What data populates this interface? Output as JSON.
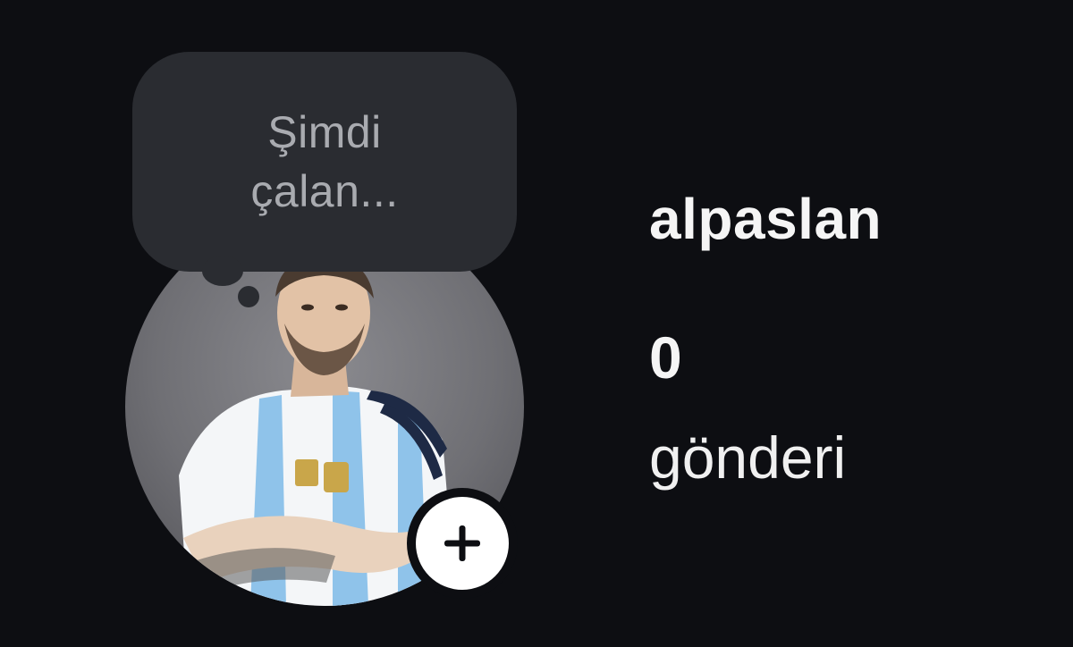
{
  "profile": {
    "note": "Şimdi çalan...",
    "username": "alpaslan",
    "stats": {
      "posts_count": "0",
      "posts_label": "gönderi"
    },
    "avatar_icon": "profile-photo",
    "add_icon": "plus-icon"
  },
  "colors": {
    "background": "#0d0e12",
    "bubble": "#2a2c31",
    "note_text": "#a9abb0",
    "text": "#f5f5f5",
    "add_button": "#ffffff"
  }
}
